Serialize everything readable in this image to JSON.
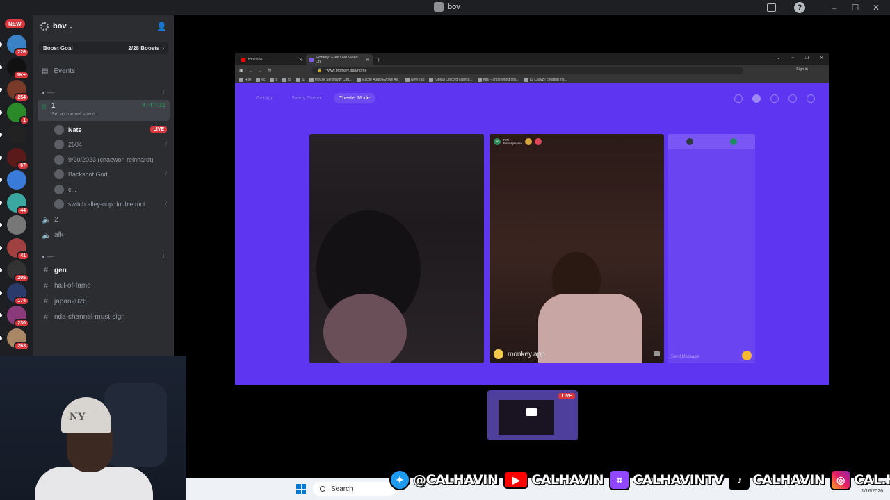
{
  "window": {
    "title": "bov"
  },
  "rail": {
    "new_badge": "NEW",
    "servers": [
      {
        "count": "226",
        "color": "#3b82c4"
      },
      {
        "count": "1K+",
        "color": "#111111"
      },
      {
        "count": "254",
        "color": "#7a3a2a"
      },
      {
        "count": "1",
        "color": "#2a8a2a"
      },
      {
        "count": "",
        "color": "#222222"
      },
      {
        "count": "67",
        "color": "#5a1a1a"
      },
      {
        "count": "",
        "color": "#3a7ad9"
      },
      {
        "count": "44",
        "color": "#3aa7a0"
      },
      {
        "count": "",
        "color": "#777777"
      },
      {
        "count": "41",
        "color": "#a04040"
      },
      {
        "count": "205",
        "color": "#333333"
      },
      {
        "count": "174",
        "color": "#2a3a6a"
      },
      {
        "count": "230",
        "color": "#8a3a7a"
      },
      {
        "count": "263",
        "color": "#aa8866"
      }
    ]
  },
  "sidebar": {
    "server_name": "bov",
    "boost_label": "Boost Goal",
    "boost_count": "2/28 Boosts",
    "events_label": "Events",
    "category1": "----",
    "voice_channel": {
      "name": "1",
      "time": "4:47:32",
      "status": "Set a channel status"
    },
    "members": [
      {
        "name": "Nate",
        "badge": "LIVE"
      },
      {
        "name": "2604",
        "badge": ""
      },
      {
        "name": "9/20/2023 (chaewon reinhardt)",
        "badge": ""
      },
      {
        "name": "Backshot God",
        "badge": ""
      },
      {
        "name": "c...",
        "badge": ""
      },
      {
        "name": "switch alley-oop double mct...",
        "badge": ""
      }
    ],
    "voice_channels": [
      "2",
      "afk"
    ],
    "category2": "----",
    "text_channels": [
      "gen",
      "hall-of-fame",
      "japan2026",
      "nda-channel-must-sign"
    ]
  },
  "browser": {
    "tabs": [
      "YouTube",
      "Monkey: Free Live Video Ch"
    ],
    "url": "www.monkey.app/home",
    "sign_in": "Sign in",
    "bookmarks": [
      "Rob",
      "ec",
      "p",
      "lol",
      "S",
      "Mouse Sensitivity Con...",
      "Excite Audio Evolve All...",
      "New Tab",
      "(3866) Discord | @esp...",
      "Kits – underworld onli...",
      "LL Clawz | creating ins..."
    ],
    "site_nav": [
      "Get App",
      "Safety Center",
      "Theater Mode"
    ],
    "peer_name": "RIN",
    "peer_sub": "Pennsylvania",
    "watermark": "monkey.app",
    "chat_placeholder": "Send Message"
  },
  "preview": {
    "live": "LIVE"
  },
  "taskbar": {
    "search": "Search",
    "date": "1/16/2026"
  },
  "socials": [
    {
      "platform": "twitter",
      "handle": "@CALHAVIN"
    },
    {
      "platform": "youtube",
      "handle": "CALHAVIN"
    },
    {
      "platform": "twitch",
      "handle": "CALHAVINTV"
    },
    {
      "platform": "tiktok",
      "handle": "CALHAVIN"
    },
    {
      "platform": "instagram",
      "handle": "CAL.HAVIN"
    }
  ]
}
